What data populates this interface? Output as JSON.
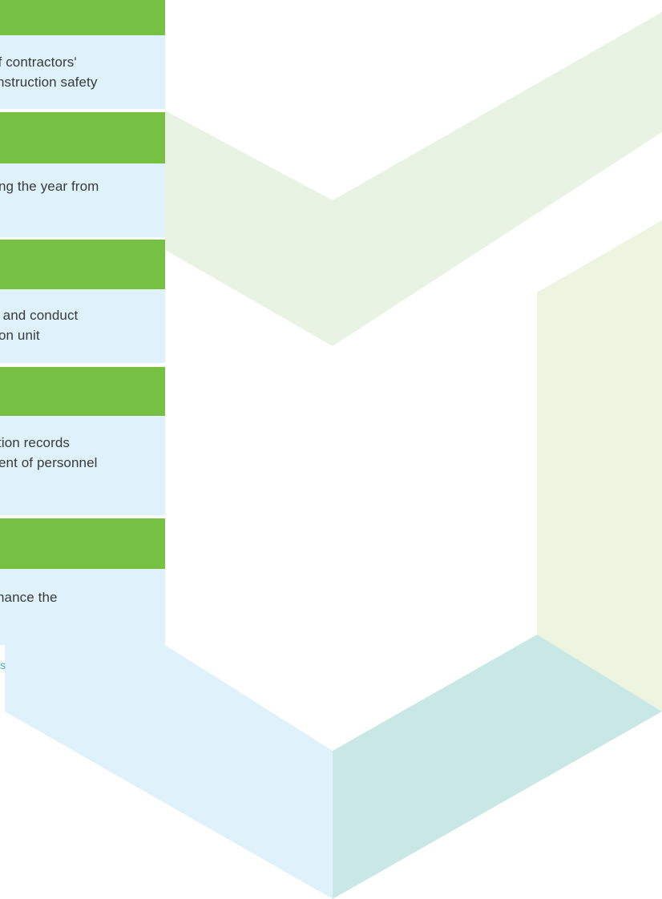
{
  "panels": [
    {
      "lines": [
        "of contractors'",
        "nstruction safety"
      ]
    },
    {
      "lines": [
        "ng the year from"
      ]
    },
    {
      "lines": [
        ", and conduct",
        "on unit"
      ]
    },
    {
      "lines": [
        "tion records",
        "ent of personnel"
      ]
    },
    {
      "lines": [
        "hance the"
      ]
    }
  ],
  "footer": {
    "link_fragment": "s"
  },
  "colors": {
    "header_bar": "#76c043",
    "text_box": "#dff1fb",
    "shape_green_light": "#e9f4e4",
    "shape_lime_light": "#edf4df",
    "shape_teal": "#c8e8e5",
    "shape_blue_light": "#dff1fb",
    "link": "#3aa8b8"
  }
}
